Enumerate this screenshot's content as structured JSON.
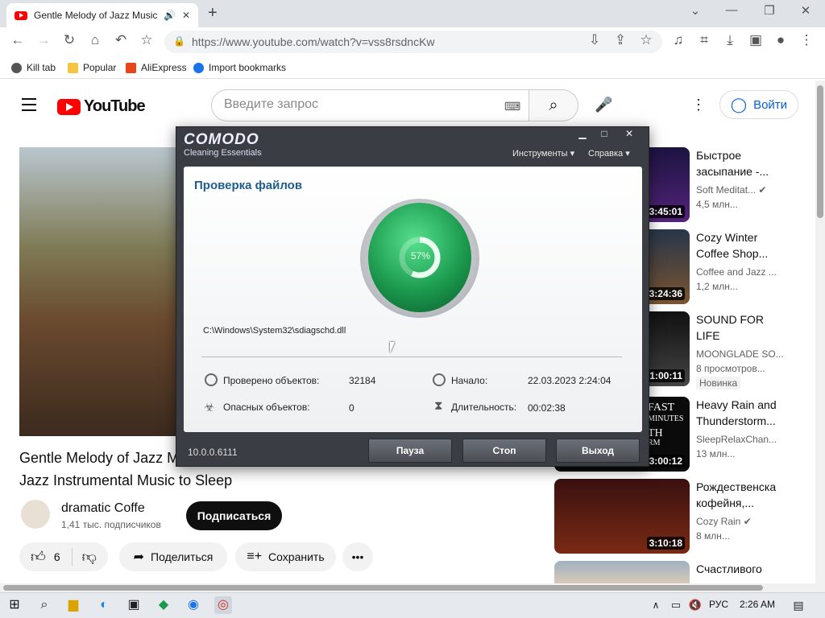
{
  "browser": {
    "tab_title": "Gentle Melody of Jazz Music in",
    "url": "https://www.youtube.com/watch?v=vss8rsdncKw",
    "bookmarks": [
      "Kill tab",
      "Popular",
      "AliExpress",
      "Import bookmarks"
    ]
  },
  "youtube": {
    "logo_text": "YouTube",
    "search_placeholder": "Введите запрос",
    "login_label": "Войти",
    "video_title_line1": "Gentle Melody of Jazz M",
    "video_title_line2": "Jazz Instrumental Music to Sleep",
    "channel_name": "dramatic Coffe",
    "channel_subs": "1,41 тыс. подписчиков",
    "subscribe_label": "Подписаться",
    "likes": "6",
    "share_label": "Поделиться",
    "save_label": "Сохранить",
    "sidebar": [
      {
        "title_l1": "Быстрое",
        "title_l2": "засыпание -...",
        "channel": "Soft Meditat...",
        "views": "4,5 млн...",
        "duration": "3:45:01"
      },
      {
        "title_l1": "Cozy Winter",
        "title_l2": "Coffee Shop...",
        "channel": "Coffee and Jazz ...",
        "views": "1,2 млн...",
        "duration": "3:24:36"
      },
      {
        "title_l1": "SOUND FOR",
        "title_l2": "LIFE",
        "channel": "MOONGLADE SO...",
        "views": "8 просмотров...",
        "duration": "1:00:11",
        "badge": "Новинка"
      },
      {
        "title_l1": "Heavy Rain and",
        "title_l2": "Thunderstorm...",
        "channel": "SleepRelaxChan...",
        "views": "13 млн...",
        "duration": "3:00:12",
        "thumb_text_1": "FAST",
        "thumb_text_2": "MINUTES",
        "thumb_text_3": "TH",
        "thumb_text_4": "RM"
      },
      {
        "title_l1": "Рождественска",
        "title_l2": "кофейня,...",
        "channel": "Cozy Rain",
        "views": "8 млн...",
        "duration": "3:10:18"
      },
      {
        "title_l1": "Счастливого",
        "title_l2": "",
        "channel": "",
        "views": "",
        "duration": ""
      }
    ]
  },
  "comodo": {
    "logo": "COMODO",
    "subtitle": "Cleaning Essentials",
    "menu_tools": "Инструменты",
    "menu_help": "Справка",
    "heading": "Проверка файлов",
    "progress_percent": 57,
    "progress_label": "57%",
    "current_file": "C:\\Windows\\System32\\sdiagschd.dll",
    "checked_label": "Проверено объектов:",
    "checked_value": "32184",
    "dangerous_label": "Опасных объектов:",
    "dangerous_value": "0",
    "start_label": "Начало:",
    "start_value": "22.03.2023 2:24:04",
    "duration_label": "Длительность:",
    "duration_value": "00:02:38",
    "version": "10.0.0.6111",
    "btn_pause": "Пауза",
    "btn_stop": "Стоп",
    "btn_exit": "Выход"
  },
  "taskbar": {
    "lang": "РУС",
    "time": "2:26 AM"
  },
  "colors": {
    "youtube_red": "#ff0000",
    "comodo_green": "#1c9a4e",
    "comodo_heading": "#1f5d8c",
    "link_blue": "#065fd4"
  }
}
